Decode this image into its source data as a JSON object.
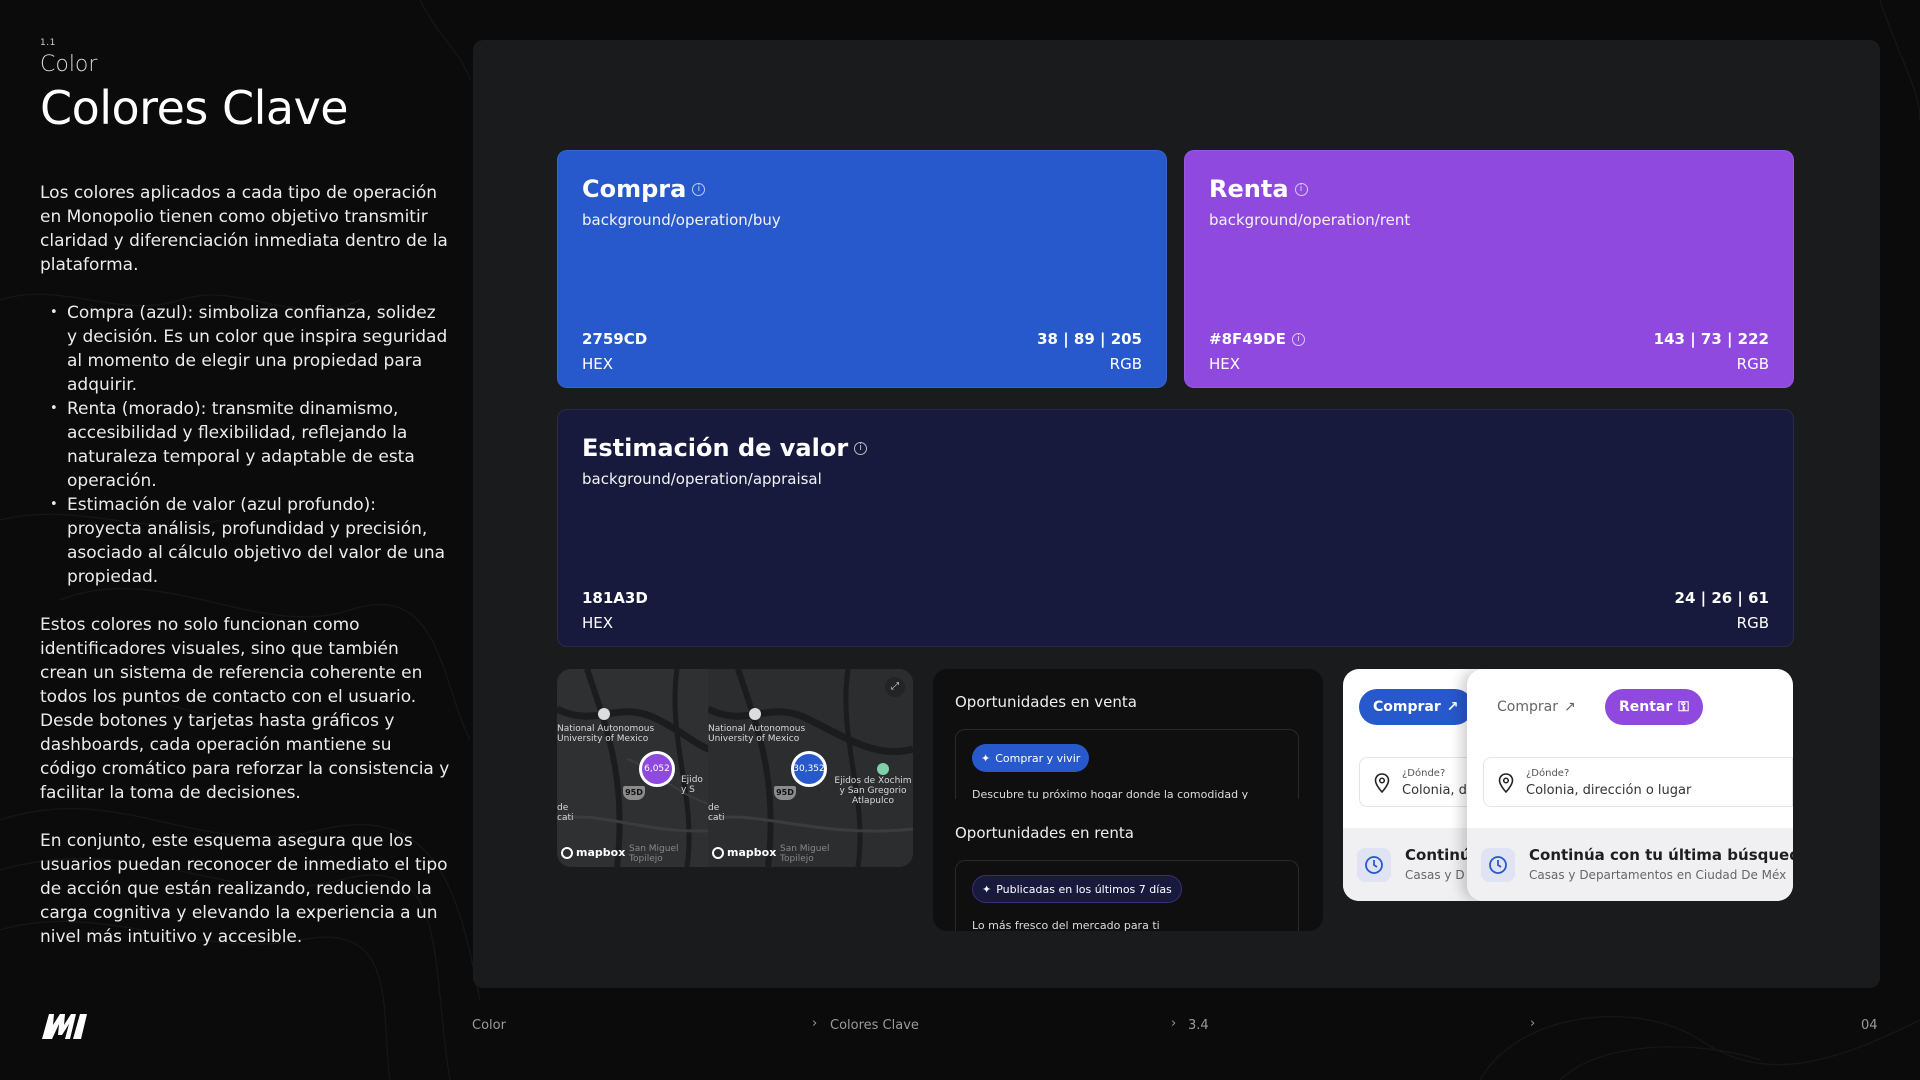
{
  "section": {
    "number": "1.1",
    "name": "Color"
  },
  "title": "Colores Clave",
  "intro": "Los colores aplicados a cada tipo de operación en Monopolio tienen como objetivo transmitir claridad y diferenciación inmediata dentro de la plataforma.",
  "bullets": [
    "Compra (azul): simboliza confianza, solidez y decisión. Es un color que inspira seguridad al momento de elegir una propiedad para adquirir.",
    "Renta (morado): transmite dinamismo, accesibilidad y flexibilidad, reflejando la naturaleza temporal y adaptable de esta operación.",
    "Estimación de valor (azul profundo): proyecta análisis, profundidad y precisión, asociado al cálculo objetivo del valor de una propiedad."
  ],
  "para2": "Estos colores no solo funcionan como identificadores visuales, sino que también crean un sistema de referencia coherente en todos los puntos de contacto con el usuario. Desde botones y tarjetas hasta gráficos y dashboards, cada operación mantiene su código cromático para reforzar la consistencia y facilitar la toma de decisiones.",
  "para3": "En conjunto, este esquema asegura que los usuarios puedan reconocer de inmediato el tipo de acción que están realizando, reduciendo la carga cognitiva y elevando la experiencia a un nivel más intuitivo y accesible.",
  "swatches": {
    "buy": {
      "name": "Compra",
      "token": "background/operation/buy",
      "hex": "2759CD",
      "hex_label": "HEX",
      "rgb": "38 | 89 | 205",
      "rgb_label": "RGB",
      "color": "#2759CD"
    },
    "rent": {
      "name": "Renta",
      "token": "background/operation/rent",
      "hex": "#8F49DE",
      "hex_label": "HEX",
      "rgb": "143 | 73 | 222",
      "rgb_label": "RGB",
      "color": "#8F49DE"
    },
    "appraisal": {
      "name": "Estimación de valor",
      "token": "background/operation/appraisal",
      "hex": "181A3D",
      "hex_label": "HEX",
      "rgb": "24 | 26 | 61",
      "rgb_label": "RGB",
      "color": "#181A3D"
    }
  },
  "map": {
    "place_a": "National Autonomous University of Mexico",
    "place_b": "Ejidos de Xochim y San Gregorio Atlapulco",
    "place_b_short": "Ejido y S",
    "place_c": "de cati",
    "place_d": "San Miguel Topilejo",
    "highway": "95D",
    "count_buy": "6,052",
    "count_rent": "30,352",
    "brand": "mapbox"
  },
  "opportunities": {
    "sale_title": "Oportunidades en venta",
    "sale_chip": "Comprar y vivir",
    "sale_desc": "Descubre tu próximo hogar donde la comodidad y",
    "rent_title": "Oportunidades en renta",
    "rent_chip": "Publicadas en los últimos 7 días",
    "rent_desc": "Lo más fresco del mercado para ti"
  },
  "search": {
    "buy_label": "Comprar",
    "rent_label": "Rentar",
    "where_label": "¿Dónde?",
    "where_placeholder": "Colonia, dirección o lugar",
    "where_short": "Colonia, dir",
    "recent_title": "Continúa con tu última búsqueda",
    "recent_title_short": "Continú",
    "recent_sub": "Casas y Departamentos en Ciudad De Méx",
    "recent_sub_short": "Casas y D"
  },
  "footer": {
    "crumb1": "Color",
    "crumb2": "Colores Clave",
    "crumb3": "3.4",
    "page": "04"
  }
}
